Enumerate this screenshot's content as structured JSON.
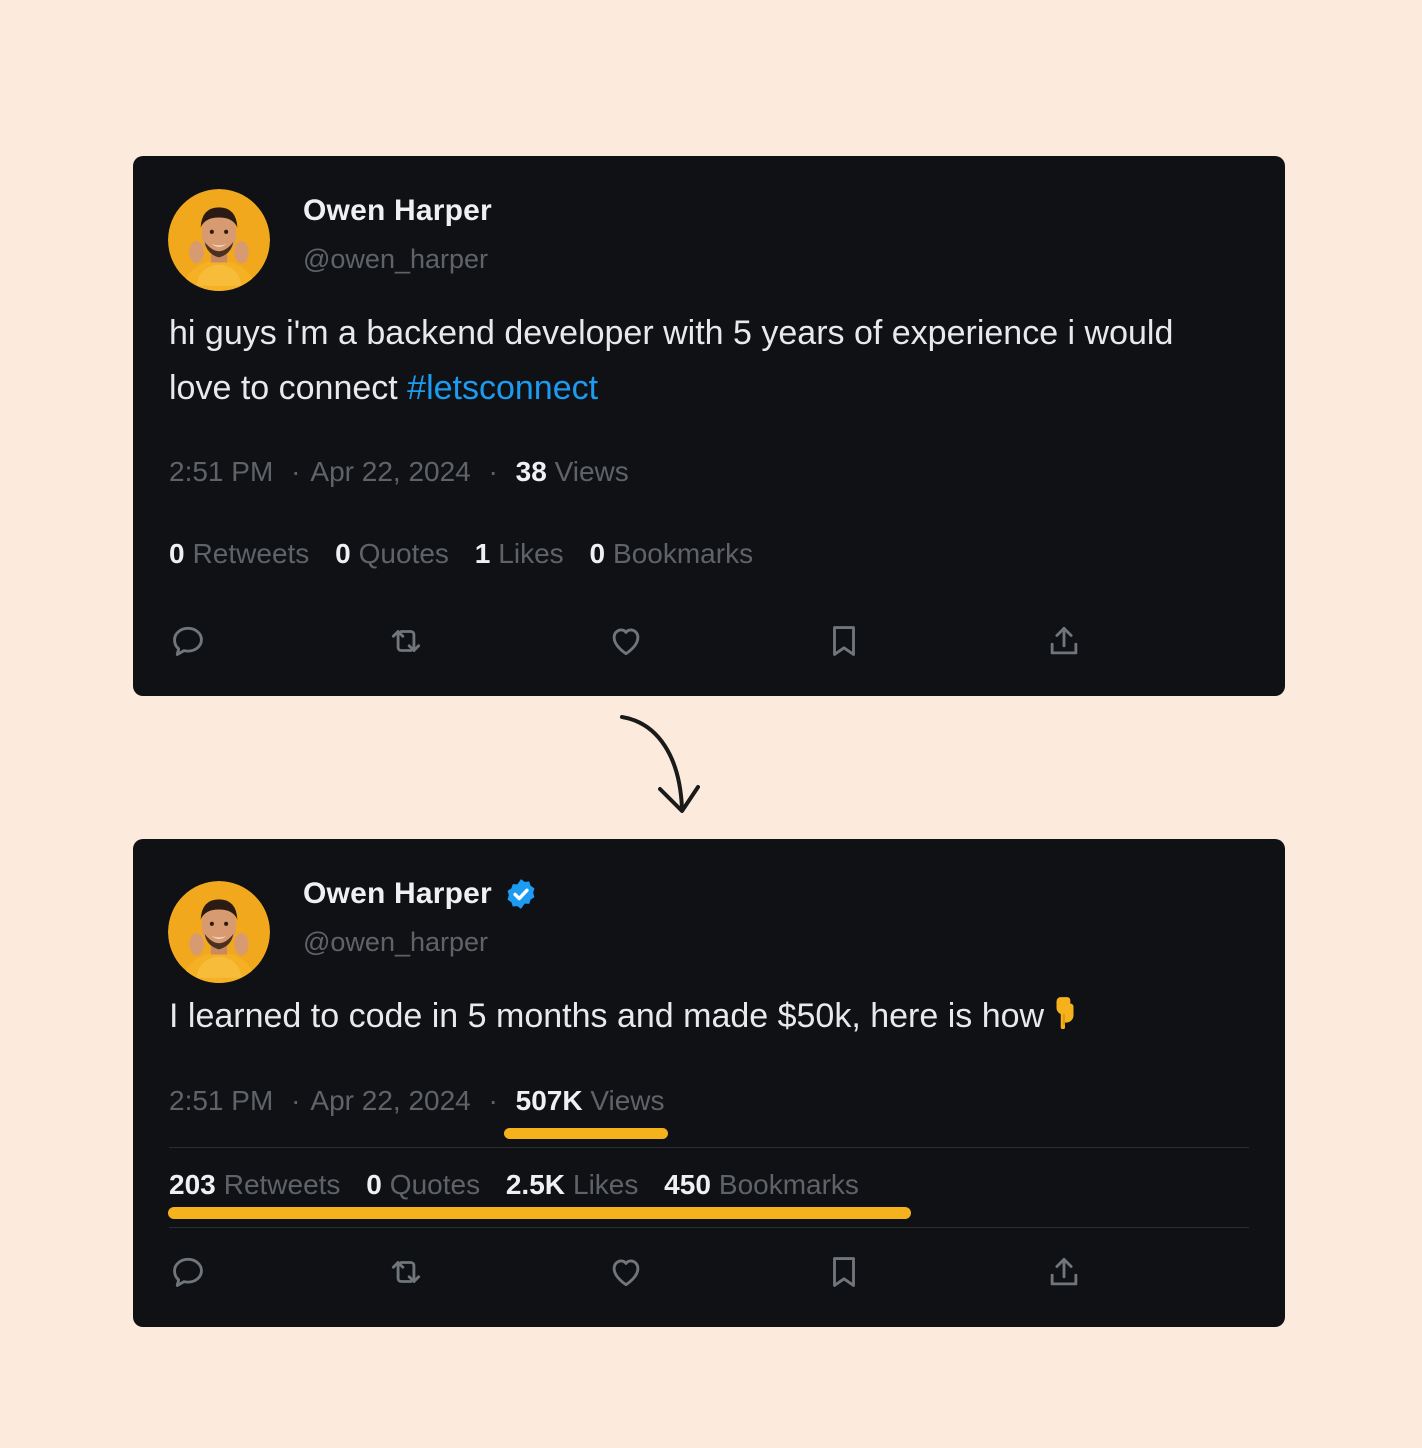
{
  "colors": {
    "background": "#fcebdc",
    "card": "#0f1115",
    "hashtag": "#1d9bf0",
    "verified": "#1d9bf0",
    "highlight": "#f6b21c"
  },
  "before": {
    "author": {
      "name": "Owen Harper",
      "handle": "@owen_harper",
      "verified": false
    },
    "text": "hi guys i'm a backend developer with 5 years of experience i would love to connect ",
    "hashtag": "#letsconnect",
    "time": "2:51 PM",
    "date": "Apr 22, 2024",
    "views": {
      "count": "38",
      "label": "Views"
    },
    "stats": {
      "retweets": {
        "count": "0",
        "label": "Retweets"
      },
      "quotes": {
        "count": "0",
        "label": "Quotes"
      },
      "likes": {
        "count": "1",
        "label": "Likes"
      },
      "bookmarks": {
        "count": "0",
        "label": "Bookmarks"
      }
    },
    "actions": [
      "reply-icon",
      "retweet-icon",
      "like-icon",
      "bookmark-icon",
      "share-icon"
    ]
  },
  "after": {
    "author": {
      "name": "Owen Harper",
      "handle": "@owen_harper",
      "verified": true
    },
    "text": "I learned to code in 5 months and made $50k, here is how",
    "emoji": "backhand-index-pointing-down",
    "time": "2:51 PM",
    "date": "Apr 22, 2024",
    "views": {
      "count": "507K",
      "label": "Views"
    },
    "stats": {
      "retweets": {
        "count": "203",
        "label": "Retweets"
      },
      "quotes": {
        "count": "0",
        "label": "Quotes"
      },
      "likes": {
        "count": "2.5K",
        "label": "Likes"
      },
      "bookmarks": {
        "count": "450",
        "label": "Bookmarks"
      }
    },
    "actions": [
      "reply-icon",
      "retweet-icon",
      "like-icon",
      "bookmark-icon",
      "share-icon"
    ]
  },
  "transition_icon": "curved-arrow-down-icon"
}
